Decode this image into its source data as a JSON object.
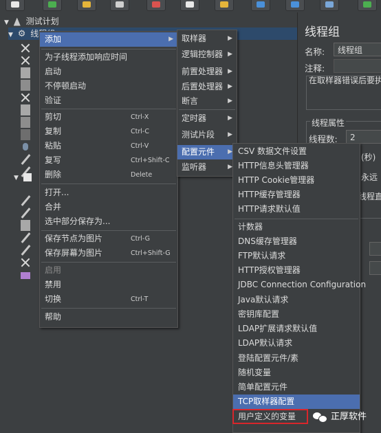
{
  "tree": {
    "root_label": "测试计划",
    "selected_label": "线程组"
  },
  "right_panel": {
    "title": "线程组",
    "name_label": "名称:",
    "name_value": "线程组",
    "comment_label": "注释:",
    "error_action_text": "在取样器错误后要执",
    "thread_props_title": "线程属性",
    "threads_label": "线程数:",
    "threads_value": "2",
    "ramp_fragment": "(秒)",
    "forever_fragment": "永远",
    "delay_fragment": "线程直"
  },
  "context_menu": {
    "items": [
      {
        "label": "添加",
        "has_submenu": true,
        "highlighted": true
      },
      {
        "label": "为子线程添加响应时间"
      },
      {
        "label": "启动"
      },
      {
        "label": "不停顿启动"
      },
      {
        "label": "验证"
      },
      {
        "label": "剪切",
        "shortcut": "Ctrl-X"
      },
      {
        "label": "复制",
        "shortcut": "Ctrl-C"
      },
      {
        "label": "粘贴",
        "shortcut": "Ctrl-V"
      },
      {
        "label": "复写",
        "shortcut": "Ctrl+Shift-C"
      },
      {
        "label": "删除",
        "shortcut": "Delete"
      },
      {
        "label": "打开..."
      },
      {
        "label": "合并"
      },
      {
        "label": "选中部分保存为..."
      },
      {
        "label": "保存节点为图片",
        "shortcut": "Ctrl-G"
      },
      {
        "label": "保存屏幕为图片",
        "shortcut": "Ctrl+Shift-G"
      },
      {
        "label": "启用",
        "disabled": true
      },
      {
        "label": "禁用"
      },
      {
        "label": "切换",
        "shortcut": "Ctrl-T"
      },
      {
        "label": "帮助"
      }
    ]
  },
  "add_submenu": {
    "items": [
      {
        "label": "取样器"
      },
      {
        "label": "逻辑控制器"
      },
      {
        "label": "前置处理器"
      },
      {
        "label": "后置处理器"
      },
      {
        "label": "断言"
      },
      {
        "label": "定时器"
      },
      {
        "label": "测试片段"
      },
      {
        "label": "配置元件",
        "highlighted": true
      },
      {
        "label": "监听器"
      }
    ]
  },
  "config_submenu": {
    "items": [
      {
        "label": "CSV 数据文件设置"
      },
      {
        "label": "HTTP信息头管理器"
      },
      {
        "label": "HTTP Cookie管理器"
      },
      {
        "label": "HTTP缓存管理器"
      },
      {
        "label": "HTTP请求默认值"
      },
      {
        "label": "计数器"
      },
      {
        "label": "DNS缓存管理器"
      },
      {
        "label": "FTP默认请求"
      },
      {
        "label": "HTTP授权管理器"
      },
      {
        "label": "JDBC Connection Configuration"
      },
      {
        "label": "Java默认请求"
      },
      {
        "label": "密钥库配置"
      },
      {
        "label": "LDAP扩展请求默认值"
      },
      {
        "label": "LDAP默认请求"
      },
      {
        "label": "登陆配置元件/素"
      },
      {
        "label": "随机变量"
      },
      {
        "label": "简单配置元件"
      },
      {
        "label": "TCP取样器配置",
        "highlighted": true
      },
      {
        "label": "用户定义的变量",
        "boxed": true
      }
    ]
  },
  "watermark": {
    "text": "正厚软件"
  },
  "colors": {
    "menu_highlight": "#4b6eaf",
    "red_box": "#d9262b",
    "background": "#3c3f41"
  }
}
